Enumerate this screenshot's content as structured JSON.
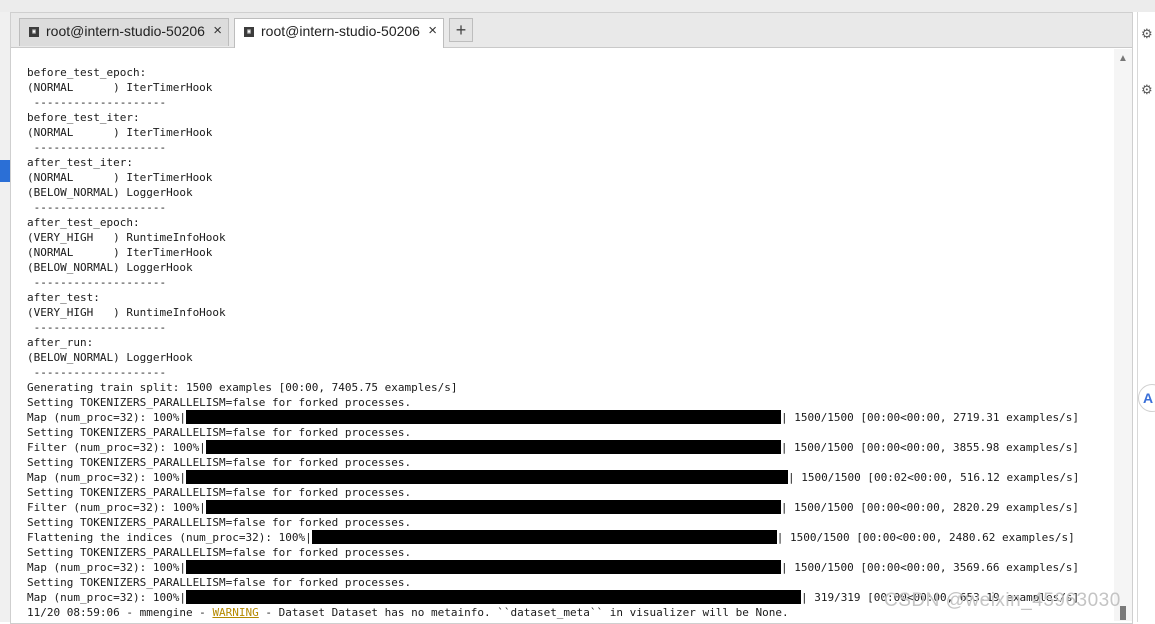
{
  "tabs": [
    {
      "title": "root@intern-studio-50206",
      "close": "×"
    },
    {
      "title": "root@intern-studio-50206",
      "close": "×"
    }
  ],
  "new_tab_label": "+",
  "tab_icon_text": "▣",
  "terminal_lines": [
    {
      "text": "before_test_epoch:"
    },
    {
      "text": "(NORMAL      ) IterTimerHook"
    },
    {
      "text": " --------------------"
    },
    {
      "text": "before_test_iter:"
    },
    {
      "text": "(NORMAL      ) IterTimerHook"
    },
    {
      "text": " --------------------"
    },
    {
      "text": "after_test_iter:"
    },
    {
      "text": "(NORMAL      ) IterTimerHook"
    },
    {
      "text": "(BELOW_NORMAL) LoggerHook"
    },
    {
      "text": " --------------------"
    },
    {
      "text": "after_test_epoch:"
    },
    {
      "text": "(VERY_HIGH   ) RuntimeInfoHook"
    },
    {
      "text": "(NORMAL      ) IterTimerHook"
    },
    {
      "text": "(BELOW_NORMAL) LoggerHook"
    },
    {
      "text": " --------------------"
    },
    {
      "text": "after_test:"
    },
    {
      "text": "(VERY_HIGH   ) RuntimeInfoHook"
    },
    {
      "text": " --------------------"
    },
    {
      "text": "after_run:"
    },
    {
      "text": "(BELOW_NORMAL) LoggerHook"
    },
    {
      "text": " --------------------"
    },
    {
      "text": "Generating train split: 1500 examples [00:00, 7405.75 examples/s]"
    },
    {
      "text": "Setting TOKENIZERS_PARALLELISM=false for forked processes."
    },
    {
      "text": "Map (num_proc=32): 100%|",
      "bar": 1.0,
      "after": "| 1500/1500 [00:00<00:00, 2719.31 examples/s]"
    },
    {
      "text": "Setting TOKENIZERS_PARALLELISM=false for forked processes."
    },
    {
      "text": "Filter (num_proc=32): 100%|",
      "bar": 1.0,
      "after": "| 1500/1500 [00:00<00:00, 3855.98 examples/s]"
    },
    {
      "text": "Setting TOKENIZERS_PARALLELISM=false for forked processes."
    },
    {
      "text": "Map (num_proc=32): 100%|",
      "bar": 1.0,
      "after": "| 1500/1500 [00:02<00:00, 516.12 examples/s]"
    },
    {
      "text": "Setting TOKENIZERS_PARALLELISM=false for forked processes."
    },
    {
      "text": "Filter (num_proc=32): 100%|",
      "bar": 1.0,
      "after": "| 1500/1500 [00:00<00:00, 2820.29 examples/s]"
    },
    {
      "text": "Setting TOKENIZERS_PARALLELISM=false for forked processes."
    },
    {
      "text": "Flattening the indices (num_proc=32): 100%|",
      "bar": 1.0,
      "after": "| 1500/1500 [00:00<00:00, 2480.62 examples/s]"
    },
    {
      "text": "Setting TOKENIZERS_PARALLELISM=false for forked processes."
    },
    {
      "text": "Map (num_proc=32): 100%|",
      "bar": 1.0,
      "after": "| 1500/1500 [00:00<00:00, 3569.66 examples/s]"
    },
    {
      "text": "Setting TOKENIZERS_PARALLELISM=false for forked processes."
    },
    {
      "text": "Map (num_proc=32): 100%|",
      "bar": 1.0,
      "after": "| 319/319 [00:00<00:00, 653.19 examples/s]"
    },
    {
      "text": "11/20 08:59:06 - mmengine - ",
      "warn": "WARNING",
      "after": " - Dataset Dataset has no metainfo. ``dataset_meta`` in visualizer will be None."
    }
  ],
  "watermark": "CSDN @weixin_45963030"
}
